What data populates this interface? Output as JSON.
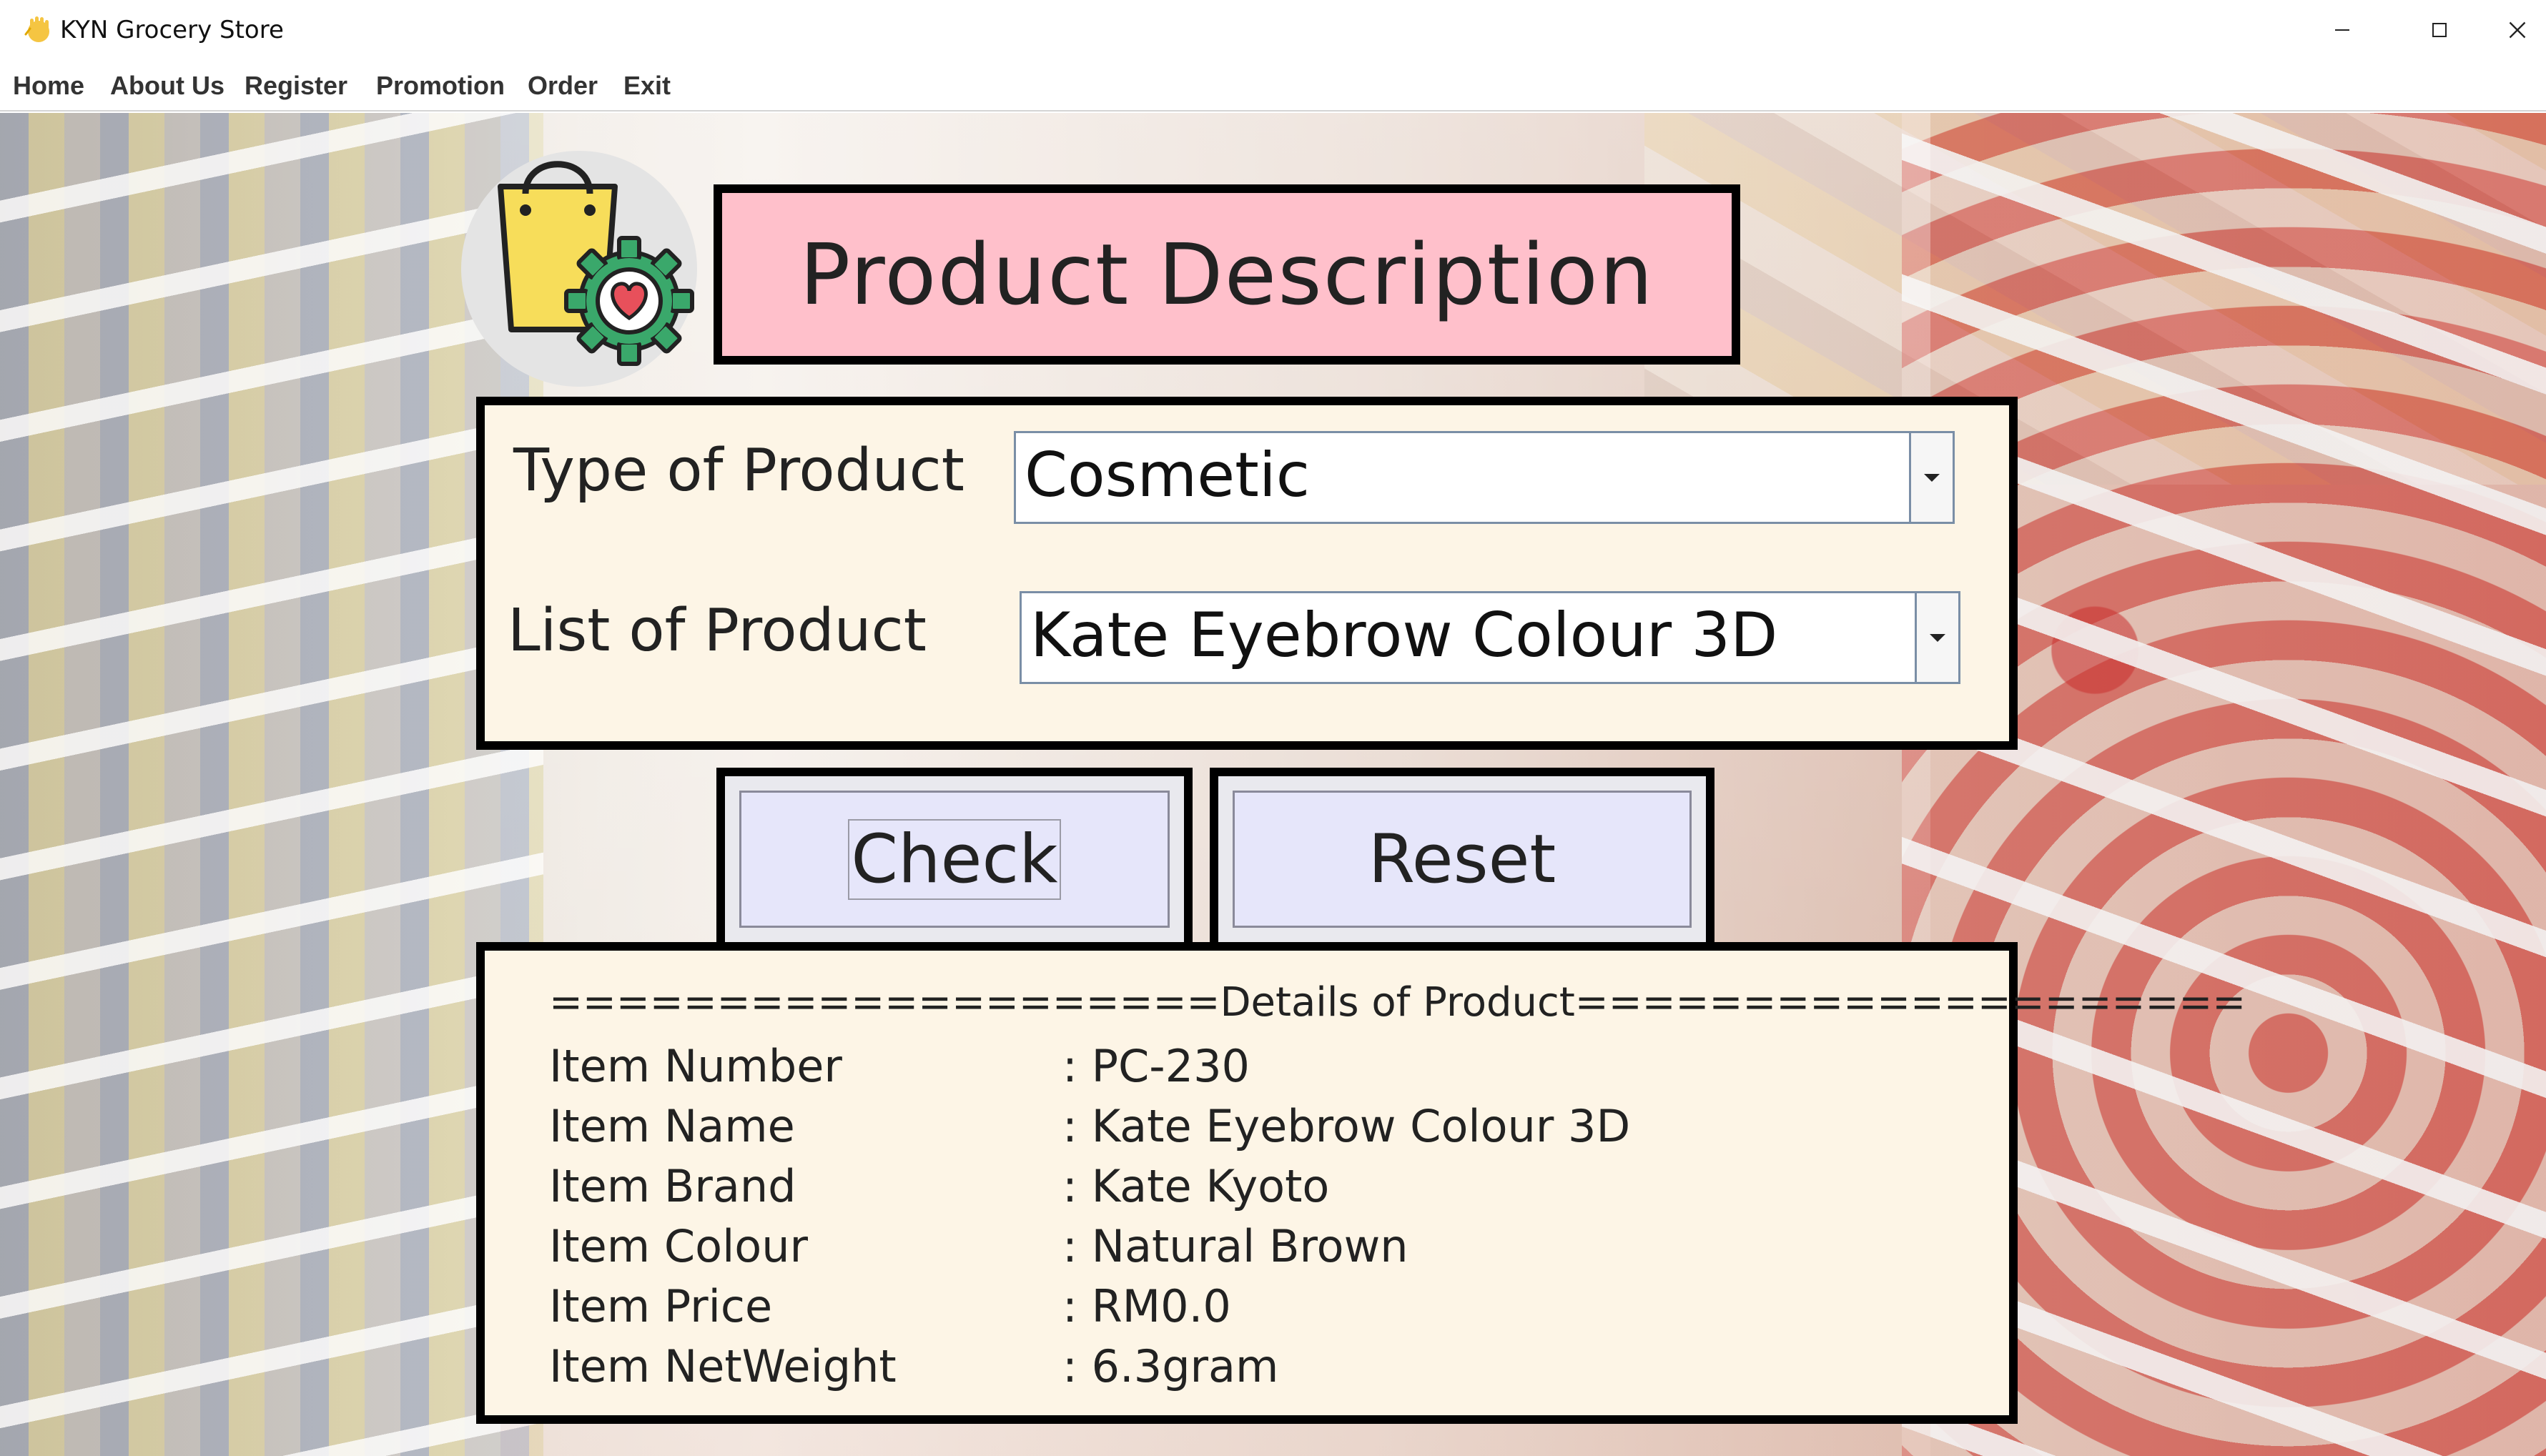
{
  "window": {
    "title": "KYN Grocery Store",
    "icon": "hand-wave-icon",
    "controls": [
      "minimize-icon",
      "maximize-icon",
      "close-icon"
    ]
  },
  "menu": {
    "items": [
      "Home",
      "About Us",
      "Register",
      "Promotion",
      "Order",
      "Exit"
    ]
  },
  "header": {
    "title": "Product Description",
    "logo": "shopping-bag-gear-heart-icon"
  },
  "form": {
    "type_label": "Type of Product",
    "type_value": "Cosmetic",
    "list_label": "List of Product",
    "list_value": "Kate Eyebrow Colour 3D"
  },
  "buttons": {
    "check": "Check",
    "reset": "Reset"
  },
  "details": {
    "header": "====================Details of Product====================",
    "rows": [
      {
        "label": "Item Number",
        "value": ": PC-230"
      },
      {
        "label": "Item Name",
        "value": ": Kate Eyebrow Colour 3D"
      },
      {
        "label": "Item Brand",
        "value": ": Kate Kyoto"
      },
      {
        "label": "Item Colour",
        "value": ": Natural Brown"
      },
      {
        "label": "Item Price",
        "value": ": RM0.0"
      },
      {
        "label": "Item NetWeight",
        "value": ": 6.3gram"
      }
    ]
  },
  "colors": {
    "title_panel": "#ffc0cb",
    "panel_bg": "#fdf5e6",
    "button_bg": "#e6e6fa",
    "border": "#000000"
  }
}
